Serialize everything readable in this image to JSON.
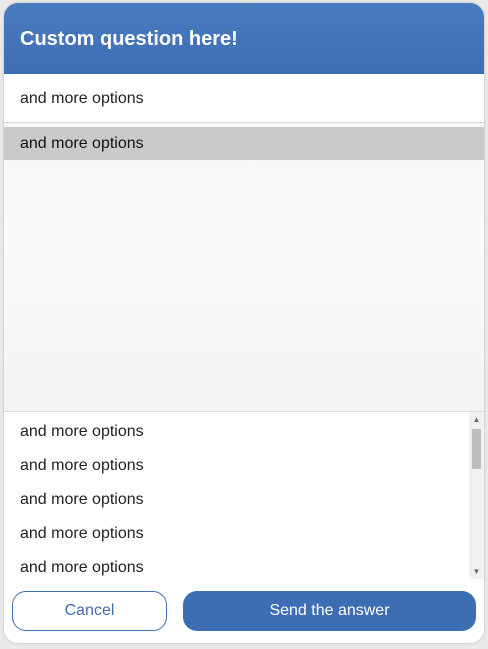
{
  "dialog": {
    "title": "Custom question here!"
  },
  "select": {
    "current_value": "and more options",
    "highlighted_option": "and more options"
  },
  "list": {
    "items": [
      "and more options",
      "and more options",
      "and more options",
      "and more options",
      "and more options"
    ]
  },
  "footer": {
    "cancel_label": "Cancel",
    "send_label": "Send the answer"
  },
  "icons": {
    "scroll_up": "scroll-up-arrow-icon",
    "scroll_down": "scroll-down-arrow-icon"
  },
  "colors": {
    "accent": "#3d6db2",
    "highlight": "#cacaca"
  }
}
